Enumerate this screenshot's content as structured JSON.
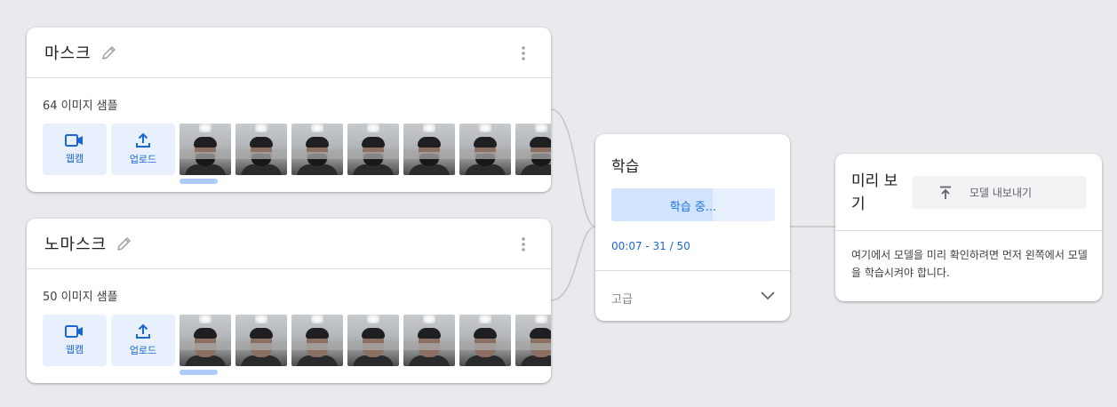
{
  "classes": [
    {
      "name": "마스크",
      "sample_count": "64 이미지 샘플",
      "webcam_label": "웹캠",
      "upload_label": "업로드",
      "masked": true
    },
    {
      "name": "노마스크",
      "sample_count": "50 이미지 샘플",
      "webcam_label": "웹캠",
      "upload_label": "업로드",
      "masked": false
    }
  ],
  "training": {
    "title": "학습",
    "button_label": "학습 중...",
    "progress_fraction": 0.62,
    "status": "00:07 - 31 / 50",
    "advanced_label": "고급"
  },
  "preview": {
    "title": "미리 보기",
    "export_label": "모델 내보내기",
    "message": "여기에서 모델을 미리 확인하려면 먼저 왼쪽에서 모델을 학습시켜야 합니다."
  },
  "colors": {
    "accent": "#1a73e8",
    "button_bg": "#e8f0fe",
    "progress_fill": "#d2e3fc",
    "background": "#e8eaed"
  },
  "icons": [
    "pencil-icon",
    "more-vert-icon",
    "webcam-icon",
    "upload-icon",
    "chevron-down-icon",
    "export-icon"
  ]
}
